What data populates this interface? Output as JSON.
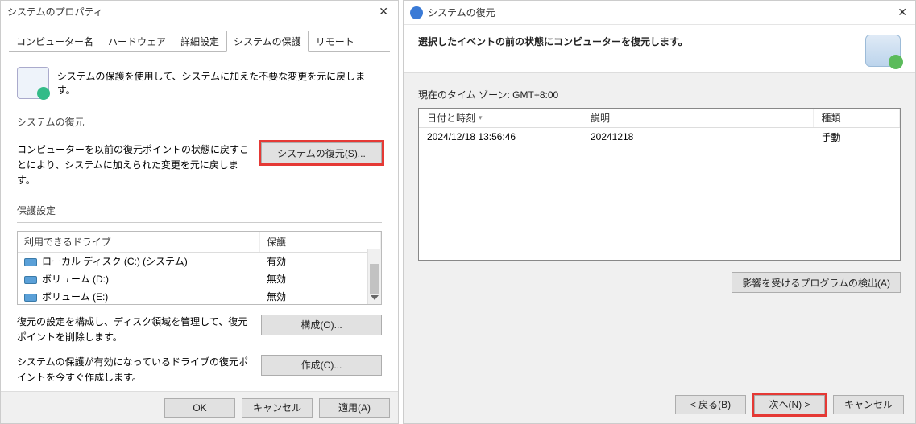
{
  "left": {
    "title": "システムのプロパティ",
    "tabs": [
      {
        "label": "コンピューター名"
      },
      {
        "label": "ハードウェア"
      },
      {
        "label": "詳細設定"
      },
      {
        "label": "システムの保護",
        "active": true
      },
      {
        "label": "リモート"
      }
    ],
    "intro": "システムの保護を使用して、システムに加えた不要な変更を元に戻します。",
    "group_restore_label": "システムの復元",
    "restore_text": "コンピューターを以前の復元ポイントの状態に戻すことにより、システムに加えられた変更を元に戻します。",
    "restore_button": "システムの復元(S)...",
    "group_protect_label": "保護設定",
    "drives_header_drive": "利用できるドライブ",
    "drives_header_prot": "保護",
    "drives": [
      {
        "name": "ローカル ディスク (C:) (システム)",
        "status": "有効"
      },
      {
        "name": "ボリューム (D:)",
        "status": "無効"
      },
      {
        "name": "ボリューム (E:)",
        "status": "無効"
      }
    ],
    "config_text": "復元の設定を構成し、ディスク領域を管理して、復元ポイントを削除します。",
    "config_button": "構成(O)...",
    "create_text": "システムの保護が有効になっているドライブの復元ポイントを今すぐ作成します。",
    "create_button": "作成(C)...",
    "footer_ok": "OK",
    "footer_cancel": "キャンセル",
    "footer_apply": "適用(A)"
  },
  "right": {
    "title": "システムの復元",
    "heading": "選択したイベントの前の状態にコンピューターを復元します。",
    "tz": "現在のタイム ゾーン: GMT+8:00",
    "th_date": "日付と時刻",
    "th_desc": "説明",
    "th_type": "種類",
    "rows": [
      {
        "date": "2024/12/18 13:56:46",
        "desc": "20241218",
        "type": "手動"
      }
    ],
    "affected_button": "影響を受けるプログラムの検出(A)",
    "footer_back": "< 戻る(B)",
    "footer_next": "次へ(N) >",
    "footer_cancel": "キャンセル"
  }
}
